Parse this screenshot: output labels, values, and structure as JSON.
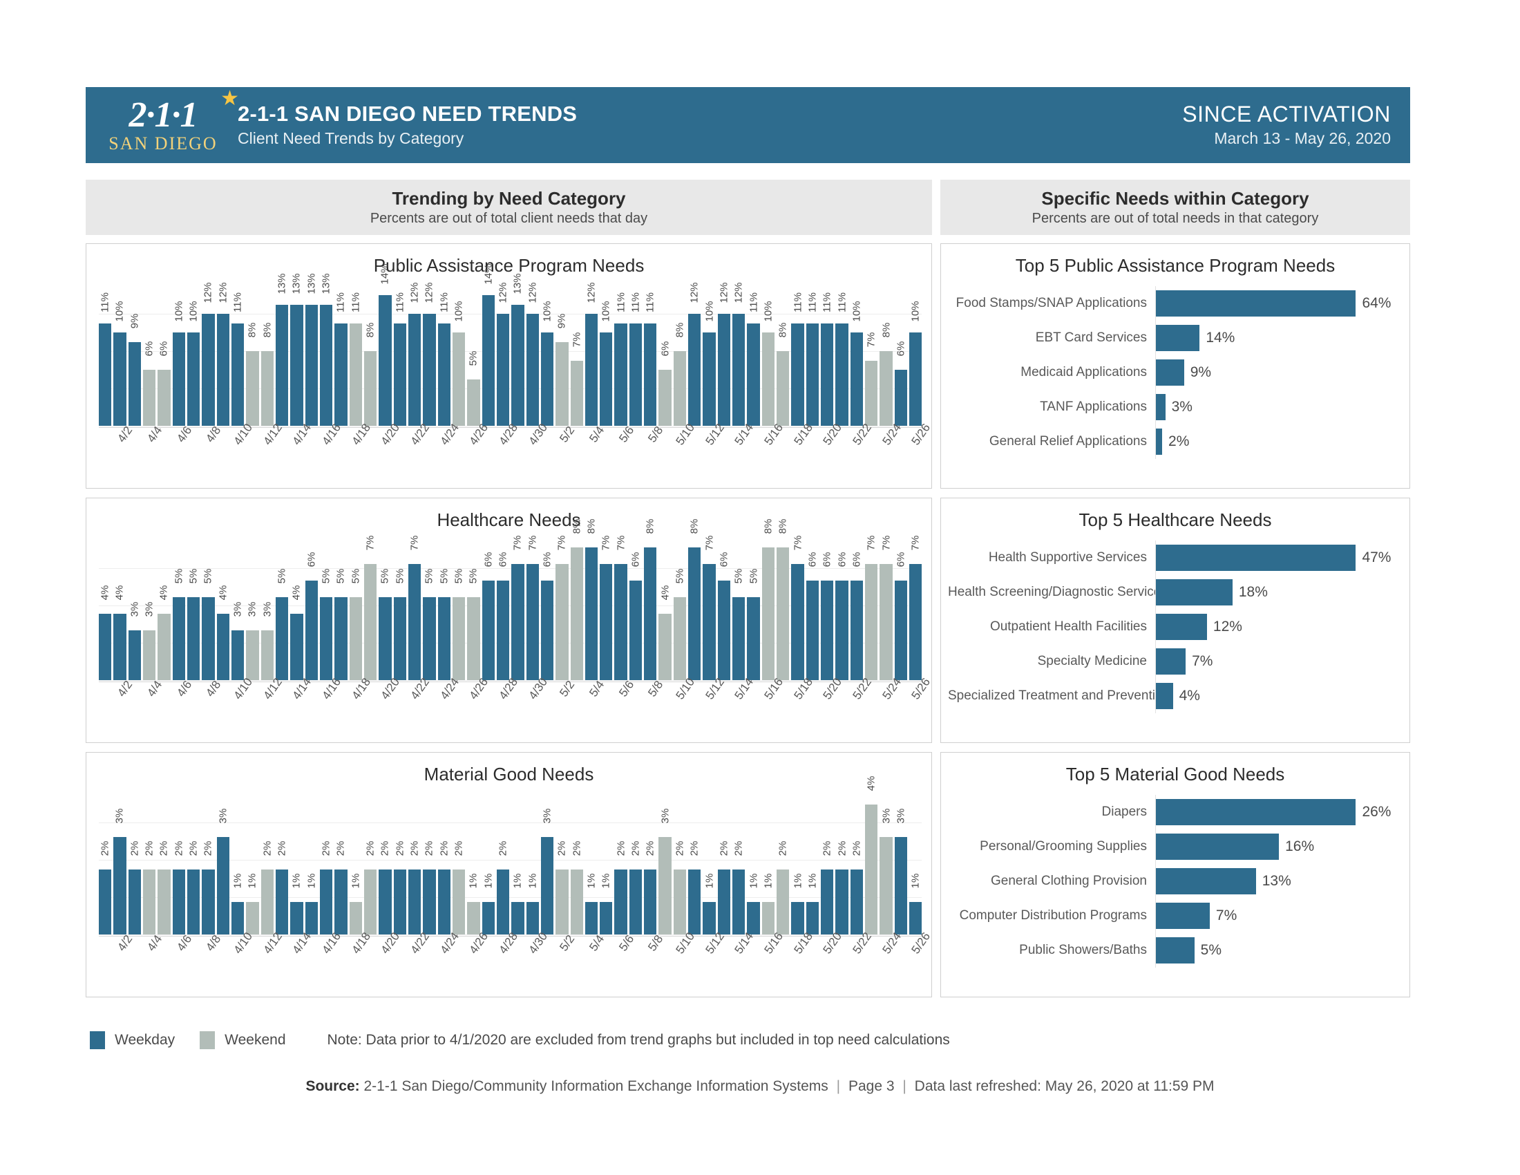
{
  "header": {
    "logo_top": "2·1·1",
    "logo_bottom": "SAN DIEGO",
    "logo_star_icon": "star-icon",
    "title": "2-1-1 SAN DIEGO NEED TRENDS",
    "subtitle": "Client Need Trends by Category",
    "since_label": "SINCE ACTIVATION",
    "date_range": "March 13 - May 26, 2020",
    "bg_color": "#2e6c8e"
  },
  "banners": {
    "left": {
      "title": "Trending by Need Category",
      "subtitle": "Percents are out of total client needs that day"
    },
    "right": {
      "title": "Specific Needs within Category",
      "subtitle": "Percents are out of total needs in that category"
    }
  },
  "legend": {
    "weekday_label": "Weekday",
    "weekend_label": "Weekend",
    "weekday_color": "#2e6c8e",
    "weekend_color": "#b2bdb8",
    "note": "Note: Data prior to 4/1/2020 are excluded from trend graphs but included in top need calculations"
  },
  "footer": {
    "source_label": "Source:",
    "source_text": "2-1-1 San Diego/Community Information Exchange Information Systems",
    "page": "Page 3",
    "refreshed": "Data last refreshed: May 26, 2020 at 11:59 PM"
  },
  "chart_data": [
    {
      "type": "bar",
      "title": "Public Assistance Program Needs",
      "xlabel": "",
      "ylabel": "",
      "ylim": [
        0,
        16
      ],
      "grid": true,
      "categories": [
        "4/1",
        "4/2",
        "4/3",
        "4/4",
        "4/5",
        "4/6",
        "4/7",
        "4/8",
        "4/9",
        "4/10",
        "4/11",
        "4/12",
        "4/13",
        "4/14",
        "4/15",
        "4/16",
        "4/17",
        "4/18",
        "4/19",
        "4/20",
        "4/21",
        "4/22",
        "4/23",
        "4/24",
        "4/25",
        "4/26",
        "4/27",
        "4/28",
        "4/29",
        "4/30",
        "5/1",
        "5/2",
        "5/3",
        "5/4",
        "5/5",
        "5/6",
        "5/7",
        "5/8",
        "5/9",
        "5/10",
        "5/11",
        "5/12",
        "5/13",
        "5/14",
        "5/15",
        "5/16",
        "5/17",
        "5/18",
        "5/19",
        "5/20",
        "5/21",
        "5/22",
        "5/23",
        "5/24",
        "5/25",
        "5/26"
      ],
      "tick_labels": [
        "",
        "4/2",
        "",
        "4/4",
        "",
        "4/6",
        "",
        "4/8",
        "",
        "4/10",
        "",
        "4/12",
        "",
        "4/14",
        "",
        "4/16",
        "",
        "4/18",
        "",
        "4/20",
        "",
        "4/22",
        "",
        "4/24",
        "",
        "4/26",
        "",
        "4/28",
        "",
        "4/30",
        "",
        "5/2",
        "",
        "5/4",
        "",
        "5/6",
        "",
        "5/8",
        "",
        "5/10",
        "",
        "5/12",
        "",
        "5/14",
        "",
        "5/16",
        "",
        "5/18",
        "",
        "5/20",
        "",
        "5/22",
        "",
        "5/24",
        "",
        "5/26"
      ],
      "values": [
        11,
        10,
        9,
        6,
        6,
        10,
        10,
        12,
        12,
        11,
        8,
        8,
        13,
        13,
        13,
        13,
        11,
        11,
        8,
        14,
        11,
        12,
        12,
        11,
        10,
        5,
        14,
        12,
        13,
        12,
        10,
        9,
        7,
        12,
        10,
        11,
        11,
        11,
        6,
        8,
        12,
        10,
        12,
        12,
        11,
        10,
        8,
        11,
        11,
        11,
        11,
        10,
        7,
        8,
        6,
        10
      ],
      "day_types": [
        "weekday",
        "weekday",
        "weekday",
        "weekend",
        "weekend",
        "weekday",
        "weekday",
        "weekday",
        "weekday",
        "weekday",
        "weekend",
        "weekend",
        "weekday",
        "weekday",
        "weekday",
        "weekday",
        "weekday",
        "weekend",
        "weekend",
        "weekday",
        "weekday",
        "weekday",
        "weekday",
        "weekday",
        "weekend",
        "weekend",
        "weekday",
        "weekday",
        "weekday",
        "weekday",
        "weekday",
        "weekend",
        "weekend",
        "weekday",
        "weekday",
        "weekday",
        "weekday",
        "weekday",
        "weekend",
        "weekend",
        "weekday",
        "weekday",
        "weekday",
        "weekday",
        "weekday",
        "weekend",
        "weekend",
        "weekday",
        "weekday",
        "weekday",
        "weekday",
        "weekday",
        "weekend",
        "weekend",
        "weekday",
        "weekday"
      ],
      "value_labels": [
        "11%",
        "10%",
        "9%",
        "6%",
        "6%",
        "10%",
        "10%",
        "12%",
        "12%",
        "11%",
        "8%",
        "8%",
        "13%",
        "13%",
        "13%",
        "13%",
        "11%",
        "11%",
        "8%",
        "14%",
        "11%",
        "12%",
        "12%",
        "11%",
        "10%",
        "5%",
        "14%",
        "12%",
        "13%",
        "12%",
        "10%",
        "9%",
        "7%",
        "12%",
        "10%",
        "11%",
        "11%",
        "11%",
        "6%",
        "8%",
        "12%",
        "10%",
        "12%",
        "12%",
        "11%",
        "10%",
        "8%",
        "11%",
        "11%",
        "11%",
        "11%",
        "10%",
        "7%",
        "8%",
        "6%",
        "10%"
      ]
    },
    {
      "type": "bar",
      "title": "Healthcare Needs",
      "xlabel": "",
      "ylabel": "",
      "ylim": [
        0,
        9
      ],
      "grid": true,
      "categories": [
        "4/1",
        "4/2",
        "4/3",
        "4/4",
        "4/5",
        "4/6",
        "4/7",
        "4/8",
        "4/9",
        "4/10",
        "4/11",
        "4/12",
        "4/13",
        "4/14",
        "4/15",
        "4/16",
        "4/17",
        "4/18",
        "4/19",
        "4/20",
        "4/21",
        "4/22",
        "4/23",
        "4/24",
        "4/25",
        "4/26",
        "4/27",
        "4/28",
        "4/29",
        "4/30",
        "5/1",
        "5/2",
        "5/3",
        "5/4",
        "5/5",
        "5/6",
        "5/7",
        "5/8",
        "5/9",
        "5/10",
        "5/11",
        "5/12",
        "5/13",
        "5/14",
        "5/15",
        "5/16",
        "5/17",
        "5/18",
        "5/19",
        "5/20",
        "5/21",
        "5/22",
        "5/23",
        "5/24",
        "5/25",
        "5/26"
      ],
      "tick_labels": [
        "",
        "4/2",
        "",
        "4/4",
        "",
        "4/6",
        "",
        "4/8",
        "",
        "4/10",
        "",
        "4/12",
        "",
        "4/14",
        "",
        "4/16",
        "",
        "4/18",
        "",
        "4/20",
        "",
        "4/22",
        "",
        "4/24",
        "",
        "4/26",
        "",
        "4/28",
        "",
        "4/30",
        "",
        "5/2",
        "",
        "5/4",
        "",
        "5/6",
        "",
        "5/8",
        "",
        "5/10",
        "",
        "5/12",
        "",
        "5/14",
        "",
        "5/16",
        "",
        "5/18",
        "",
        "5/20",
        "",
        "5/22",
        "",
        "5/24",
        "",
        "5/26"
      ],
      "values": [
        4,
        4,
        3,
        3,
        4,
        5,
        5,
        5,
        4,
        3,
        3,
        3,
        5,
        4,
        6,
        5,
        5,
        5,
        7,
        5,
        5,
        7,
        5,
        5,
        5,
        5,
        6,
        6,
        7,
        7,
        6,
        7,
        8,
        8,
        7,
        7,
        6,
        8,
        4,
        5,
        8,
        7,
        6,
        5,
        5,
        8,
        8,
        7,
        6,
        6,
        6,
        6,
        7,
        7,
        6,
        7
      ],
      "day_types": [
        "weekday",
        "weekday",
        "weekday",
        "weekend",
        "weekend",
        "weekday",
        "weekday",
        "weekday",
        "weekday",
        "weekday",
        "weekend",
        "weekend",
        "weekday",
        "weekday",
        "weekday",
        "weekday",
        "weekday",
        "weekend",
        "weekend",
        "weekday",
        "weekday",
        "weekday",
        "weekday",
        "weekday",
        "weekend",
        "weekend",
        "weekday",
        "weekday",
        "weekday",
        "weekday",
        "weekday",
        "weekend",
        "weekend",
        "weekday",
        "weekday",
        "weekday",
        "weekday",
        "weekday",
        "weekend",
        "weekend",
        "weekday",
        "weekday",
        "weekday",
        "weekday",
        "weekday",
        "weekend",
        "weekend",
        "weekday",
        "weekday",
        "weekday",
        "weekday",
        "weekday",
        "weekend",
        "weekend",
        "weekday",
        "weekday"
      ],
      "value_labels": [
        "4%",
        "4%",
        "3%",
        "3%",
        "4%",
        "5%",
        "5%",
        "5%",
        "4%",
        "3%",
        "3%",
        "3%",
        "5%",
        "4%",
        "6%",
        "5%",
        "5%",
        "5%",
        "7%",
        "5%",
        "5%",
        "7%",
        "5%",
        "5%",
        "5%",
        "5%",
        "6%",
        "6%",
        "7%",
        "7%",
        "6%",
        "7%",
        "8%",
        "8%",
        "7%",
        "7%",
        "6%",
        "8%",
        "4%",
        "5%",
        "8%",
        "7%",
        "6%",
        "5%",
        "5%",
        "8%",
        "8%",
        "7%",
        "6%",
        "6%",
        "6%",
        "6%",
        "7%",
        "7%",
        "6%",
        "7%"
      ]
    },
    {
      "type": "bar",
      "title": "Material Good Needs",
      "xlabel": "",
      "ylabel": "",
      "ylim": [
        0,
        4.6
      ],
      "grid": true,
      "categories": [
        "4/1",
        "4/2",
        "4/3",
        "4/4",
        "4/5",
        "4/6",
        "4/7",
        "4/8",
        "4/9",
        "4/10",
        "4/11",
        "4/12",
        "4/13",
        "4/14",
        "4/15",
        "4/16",
        "4/17",
        "4/18",
        "4/19",
        "4/20",
        "4/21",
        "4/22",
        "4/23",
        "4/24",
        "4/25",
        "4/26",
        "4/27",
        "4/28",
        "4/29",
        "4/30",
        "5/1",
        "5/2",
        "5/3",
        "5/4",
        "5/5",
        "5/6",
        "5/7",
        "5/8",
        "5/9",
        "5/10",
        "5/11",
        "5/12",
        "5/13",
        "5/14",
        "5/15",
        "5/16",
        "5/17",
        "5/18",
        "5/19",
        "5/20",
        "5/21",
        "5/22",
        "5/23",
        "5/24",
        "5/25",
        "5/26"
      ],
      "tick_labels": [
        "",
        "4/2",
        "",
        "4/4",
        "",
        "4/6",
        "",
        "4/8",
        "",
        "4/10",
        "",
        "4/12",
        "",
        "4/14",
        "",
        "4/16",
        "",
        "4/18",
        "",
        "4/20",
        "",
        "4/22",
        "",
        "4/24",
        "",
        "4/26",
        "",
        "4/28",
        "",
        "4/30",
        "",
        "5/2",
        "",
        "5/4",
        "",
        "5/6",
        "",
        "5/8",
        "",
        "5/10",
        "",
        "5/12",
        "",
        "5/14",
        "",
        "5/16",
        "",
        "5/18",
        "",
        "5/20",
        "",
        "5/22",
        "",
        "5/24",
        "",
        "5/26"
      ],
      "values": [
        2,
        3,
        2,
        2,
        2,
        2,
        2,
        2,
        3,
        1,
        1,
        2,
        2,
        1,
        1,
        2,
        2,
        1,
        2,
        2,
        2,
        2,
        2,
        2,
        2,
        1,
        1,
        2,
        1,
        1,
        3,
        2,
        2,
        1,
        1,
        2,
        2,
        2,
        3,
        2,
        2,
        1,
        2,
        2,
        1,
        1,
        2,
        1,
        1,
        2,
        2,
        2,
        4,
        3,
        3,
        1
      ],
      "day_types": [
        "weekday",
        "weekday",
        "weekday",
        "weekend",
        "weekend",
        "weekday",
        "weekday",
        "weekday",
        "weekday",
        "weekday",
        "weekend",
        "weekend",
        "weekday",
        "weekday",
        "weekday",
        "weekday",
        "weekday",
        "weekend",
        "weekend",
        "weekday",
        "weekday",
        "weekday",
        "weekday",
        "weekday",
        "weekend",
        "weekend",
        "weekday",
        "weekday",
        "weekday",
        "weekday",
        "weekday",
        "weekend",
        "weekend",
        "weekday",
        "weekday",
        "weekday",
        "weekday",
        "weekday",
        "weekend",
        "weekend",
        "weekday",
        "weekday",
        "weekday",
        "weekday",
        "weekday",
        "weekend",
        "weekend",
        "weekday",
        "weekday",
        "weekday",
        "weekday",
        "weekday",
        "weekend",
        "weekend",
        "weekday",
        "weekday"
      ],
      "value_labels": [
        "2%",
        "3%",
        "2%",
        "2%",
        "2%",
        "2%",
        "2%",
        "2%",
        "3%",
        "1%",
        "1%",
        "2%",
        "2%",
        "1%",
        "1%",
        "2%",
        "2%",
        "1%",
        "2%",
        "2%",
        "2%",
        "2%",
        "2%",
        "2%",
        "2%",
        "1%",
        "1%",
        "2%",
        "1%",
        "1%",
        "3%",
        "2%",
        "2%",
        "1%",
        "1%",
        "2%",
        "2%",
        "2%",
        "3%",
        "2%",
        "2%",
        "1%",
        "2%",
        "2%",
        "1%",
        "1%",
        "2%",
        "1%",
        "1%",
        "2%",
        "2%",
        "2%",
        "4%",
        "3%",
        "3%",
        "1%"
      ]
    },
    {
      "type": "bar",
      "orientation": "horizontal",
      "title": "Top 5 Public Assistance Program Needs",
      "categories": [
        "Food Stamps/SNAP Applications",
        "EBT Card Services",
        "Medicaid Applications",
        "TANF Applications",
        "General Relief Applications"
      ],
      "values": [
        64,
        14,
        9,
        3,
        2
      ],
      "value_labels": [
        "64%",
        "14%",
        "9%",
        "3%",
        "2%"
      ],
      "xlim": [
        0,
        64
      ]
    },
    {
      "type": "bar",
      "orientation": "horizontal",
      "title": "Top 5 Healthcare Needs",
      "categories": [
        "Health Supportive Services",
        "Health Screening/Diagnostic Services",
        "Outpatient Health Facilities",
        "Specialty Medicine",
        "Specialized Treatment and Prevention"
      ],
      "values": [
        47,
        18,
        12,
        7,
        4
      ],
      "value_labels": [
        "47%",
        "18%",
        "12%",
        "7%",
        "4%"
      ],
      "xlim": [
        0,
        47
      ]
    },
    {
      "type": "bar",
      "orientation": "horizontal",
      "title": "Top 5 Material Good Needs",
      "categories": [
        "Diapers",
        "Personal/Grooming Supplies",
        "General Clothing Provision",
        "Computer Distribution Programs",
        "Public Showers/Baths"
      ],
      "values": [
        26,
        16,
        13,
        7,
        5
      ],
      "value_labels": [
        "26%",
        "16%",
        "13%",
        "7%",
        "5%"
      ],
      "xlim": [
        0,
        26
      ]
    }
  ]
}
